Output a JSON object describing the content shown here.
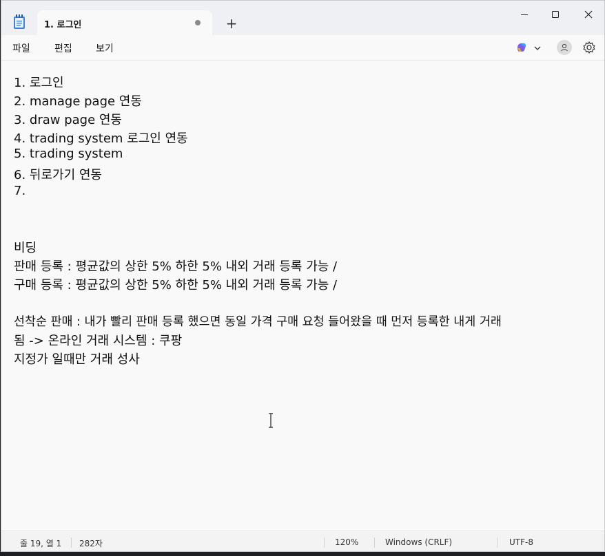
{
  "tab": {
    "title": "1. 로그인"
  },
  "menu": {
    "file": "파일",
    "edit": "편집",
    "view": "보기"
  },
  "editor": {
    "lines": [
      "1. 로그인",
      "2. manage page 연동",
      "3. draw page 연동",
      "4. trading system 로그인 연동",
      "5. trading system",
      "6. 뒤로가기 연동",
      "7.",
      "",
      "",
      "비딩",
      "판매 등록 : 평균값의 상한 5% 하한 5% 내외 거래 등록 가능 /",
      "구매 등록 : 평균값의 상한 5% 하한 5% 내외 거래 등록 가능 /",
      "",
      "선착순 판매 : 내가 빨리 판매 등록 했으면 동일 가격 구매 요청 들어왔을 때 먼저 등록한 내게 거래",
      "됨 -> 온라인 거래 시스템 : 쿠팡",
      "지정가 일때만 거래 성사"
    ]
  },
  "status": {
    "position": "줄 19, 열 1",
    "chars": "282자",
    "zoom": "120%",
    "eol": "Windows (CRLF)",
    "encoding": "UTF-8"
  },
  "icons": {
    "app": "notepad-icon",
    "new_tab": "plus-icon",
    "minimize": "minimize-icon",
    "maximize": "maximize-icon",
    "close": "close-icon",
    "copilot": "copilot-icon",
    "dropdown": "chevron-down-icon",
    "account": "account-icon",
    "settings": "gear-icon",
    "cursor": "text-cursor-icon"
  },
  "colors": {
    "accent": "#2b7de9",
    "background": "#f9f9f9",
    "titlebar": "#eef0f4"
  }
}
